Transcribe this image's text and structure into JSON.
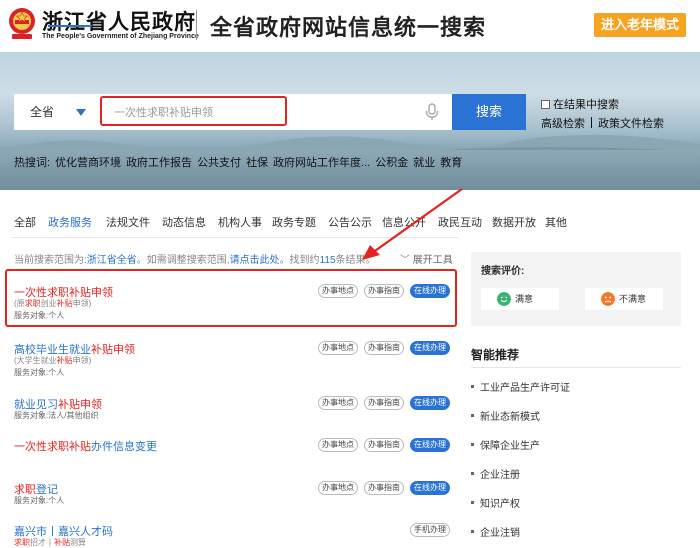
{
  "header": {
    "site_name": "浙江省人民政府",
    "site_name_en": "The People's Government of Zhejiang Province",
    "title": "全省政府网站信息统一搜索",
    "elder_mode": "进入老年模式",
    "brand_color": "#f5a320"
  },
  "search": {
    "scope": "全省",
    "value": "一次性求职补贴申领",
    "button": "搜索",
    "checkbox_label": "在结果中搜索",
    "advanced": "高级检索",
    "policy": "政策文件检索",
    "hot_label": "热搜词:",
    "hot_words": [
      "优化营商环境",
      "政府工作报告",
      "公共支付",
      "社保",
      "政府网站工作年度...",
      "公积金",
      "就业",
      "教育"
    ]
  },
  "tabs": [
    "全部",
    "政务服务",
    "法规文件",
    "动态信息",
    "机构人事",
    "政务专题",
    "公告公示",
    "信息公开",
    "政民互动",
    "数据开放",
    "其他"
  ],
  "scope_info": {
    "prefix": "当前搜索范围为:",
    "scope": "浙江省全省",
    "middle": "。如需调整搜索范围,",
    "link": "请点击此处",
    "count_prefix": "。找到约",
    "count": "115",
    "count_suffix": "条结果。"
  },
  "expand_tools": "展开工具",
  "results": [
    {
      "title": [
        "",
        "一次性求职补贴申领",
        ""
      ],
      "sub": [
        "(原",
        "求职",
        "创业",
        "补贴",
        "申领)"
      ],
      "target": "服务对象:个人",
      "buttons": [
        "办事地点",
        "办事指南",
        "在线办理"
      ]
    },
    {
      "title": [
        "高校毕业生就业",
        "补贴申领",
        ""
      ],
      "sub": [
        "(大学生就业",
        "补贴",
        "申领)"
      ],
      "target": "服务对象:个人",
      "buttons": [
        "办事地点",
        "办事指南",
        "在线办理"
      ]
    },
    {
      "title": [
        "就业见习",
        "补贴申领",
        ""
      ],
      "target": "服务对象:法人/其他组织",
      "buttons": [
        "办事地点",
        "办事指南",
        "在线办理"
      ]
    },
    {
      "title": [
        "",
        "一次性求职补贴",
        "办件信息变更"
      ],
      "target": "",
      "buttons": [
        "办事地点",
        "办事指南",
        "在线办理"
      ]
    },
    {
      "title": [
        "",
        "求职",
        "登记"
      ],
      "target": "服务对象:个人",
      "buttons": [
        "办事地点",
        "办事指南",
        "在线办理"
      ]
    },
    {
      "title": [
        "嘉兴市丨嘉兴人才码",
        "",
        ""
      ],
      "sub": [
        "",
        "求职",
        "招才丨",
        "补贴",
        "测算"
      ],
      "buttons": [
        "手机办理"
      ]
    }
  ],
  "evaluation": {
    "title": "搜索评价:",
    "satisfied": "满意",
    "unsatisfied": "不满意"
  },
  "recommend": {
    "title": "智能推荐",
    "items": [
      "工业产品生产许可证",
      "新业态新模式",
      "保障企业生产",
      "企业注册",
      "知识产权",
      "企业注销"
    ]
  }
}
